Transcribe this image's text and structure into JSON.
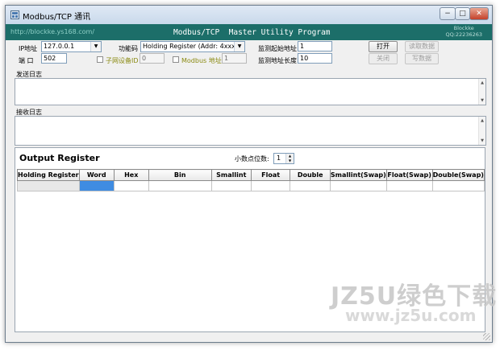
{
  "window": {
    "title": "Modbus/TCP 通讯",
    "min_glyph": "−",
    "max_glyph": "□",
    "close_glyph": "✕"
  },
  "banner": {
    "url": "http://blockke.ys168.com/",
    "title": "Modbus/TCP  Master Utility Program",
    "author_line1": "Blockke",
    "author_line2": "QQ:22236263"
  },
  "settings": {
    "ip_label": "IP地址",
    "ip_value": "127.0.0.1",
    "port_label": "端 口",
    "port_value": "502",
    "function_label": "功能码",
    "function_value": "Holding Register (Addr: 4xxxx)",
    "slave_id_label": "子网设备ID",
    "slave_id_value": "0",
    "modbus_addr_label": "Modbus 地址",
    "modbus_addr_value": "1",
    "monitor_start_label": "监测起始地址",
    "monitor_start_value": "1",
    "monitor_length_label": "监测地址长度",
    "monitor_length_value": "10"
  },
  "buttons": {
    "open": "打开",
    "close": "关闭",
    "read": "读取数据",
    "write": "写数据"
  },
  "logs": {
    "send_label": "发送日志",
    "receive_label": "接收日志"
  },
  "output": {
    "title": "Output Register",
    "decimal_label": "小数点位数:",
    "decimal_value": "1",
    "columns": [
      "Holding Register",
      "Word",
      "Hex",
      "Bin",
      "Smallint",
      "Float",
      "Double",
      "Smallint(Swap)",
      "Float(Swap)",
      "Double(Swap)"
    ]
  },
  "watermark": {
    "line1": "JZ5U绿色下载",
    "line2": "www.jz5u.com"
  },
  "colors": {
    "banner_bg": "#1c6e69",
    "selected_cell": "#3f8ce2",
    "window_bg": "#f0f0f0"
  }
}
